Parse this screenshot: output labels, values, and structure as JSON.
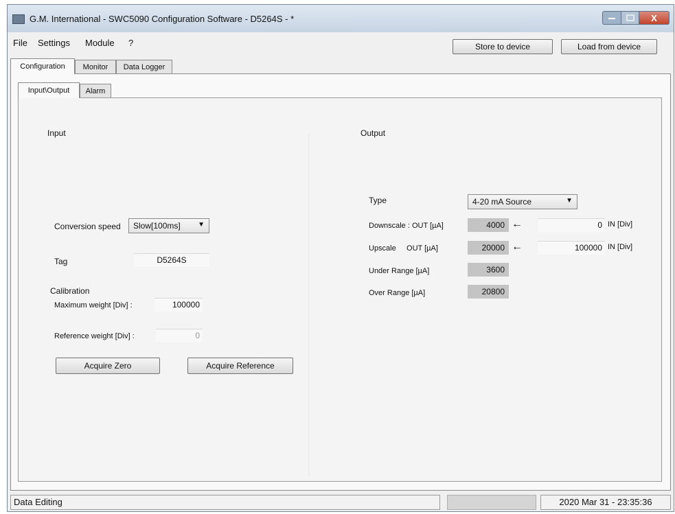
{
  "window": {
    "title": "G.M. International - SWC5090 Configuration Software - D5264S - *",
    "close_glyph": "X"
  },
  "menu": [
    "File",
    "Settings",
    "Module",
    "?"
  ],
  "toolbar": {
    "store_label": "Store to device",
    "load_label": "Load from device"
  },
  "tabs": [
    "Configuration",
    "Monitor",
    "Data Logger"
  ],
  "subtabs": [
    "Input\\Output",
    "Alarm"
  ],
  "input": {
    "title": "Input",
    "conversion_speed_label": "Conversion speed",
    "conversion_speed_value": "Slow[100ms]",
    "tag_label": "Tag",
    "tag_value": "D5264S",
    "calibration_title": "Calibration",
    "max_weight_label": "Maximum weight [Div] :",
    "max_weight_value": "100000",
    "ref_weight_label": "Reference weight [Div] :",
    "ref_weight_value": "0",
    "acquire_zero_label": "Acquire Zero",
    "acquire_ref_label": "Acquire Reference"
  },
  "output": {
    "title": "Output",
    "type_label": "Type",
    "type_value": "4-20 mA Source",
    "downscale_label": "Downscale : OUT [µA]",
    "downscale_out": "4000",
    "downscale_in": "0",
    "upscale_label": "Upscale     OUT [µA]",
    "upscale_out": "20000",
    "upscale_in": "100000",
    "in_unit_label": "IN [Div]",
    "arrow": "←",
    "under_range_label": "Under Range [µA]",
    "under_range_value": "3600",
    "over_range_label": "Over Range [µA]",
    "over_range_value": "20800"
  },
  "status": {
    "left_text": "Data Editing",
    "datetime": "2020 Mar 31 - 23:35:36"
  },
  "icons": {
    "dropdown": "chevron-down-icon",
    "app": "app-icon"
  }
}
